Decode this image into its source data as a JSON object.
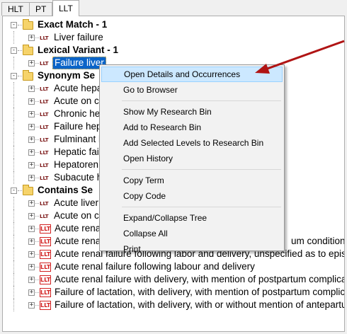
{
  "tabs": [
    "HLT",
    "PT",
    "LLT"
  ],
  "active_tab": "LLT",
  "icons": {
    "level_badge": "LLT",
    "folder": "folder-icon",
    "expander": "+",
    "collapser": "-"
  },
  "colors": {
    "selection": "#0a64c8",
    "menu_highlight": "#cce8ff",
    "arrow": "#b01414",
    "llt_badge": "#d22020"
  },
  "tree": [
    {
      "type": "group",
      "label": "Exact Match - 1"
    },
    {
      "type": "term",
      "label": "Liver failure",
      "icon": "small"
    },
    {
      "type": "group",
      "label": "Lexical Variant - 1"
    },
    {
      "type": "term",
      "label": "Failure liver",
      "icon": "small",
      "selected": true
    },
    {
      "type": "group",
      "label": "Synonym Se"
    },
    {
      "type": "term",
      "label": "Acute hepa",
      "icon": "small"
    },
    {
      "type": "term",
      "label": "Acute on c",
      "icon": "small"
    },
    {
      "type": "term",
      "label": "Chronic he",
      "icon": "small"
    },
    {
      "type": "term",
      "label": "Failure hep",
      "icon": "small"
    },
    {
      "type": "term",
      "label": "Fulminant h",
      "icon": "small"
    },
    {
      "type": "term",
      "label": "Hepatic fai",
      "icon": "small"
    },
    {
      "type": "term",
      "label": "Hepatoren",
      "icon": "small"
    },
    {
      "type": "term",
      "label": "Subacute h",
      "icon": "small"
    },
    {
      "type": "group",
      "label": "Contains Se"
    },
    {
      "type": "term",
      "label": "Acute liver",
      "icon": "small"
    },
    {
      "type": "term",
      "label": "Acute on c",
      "icon": "small"
    },
    {
      "type": "term",
      "label": "Acute renal",
      "icon": "box"
    },
    {
      "type": "term",
      "label": "Acute rena",
      "tail": "um condition",
      "icon": "box"
    },
    {
      "type": "term",
      "label": "Acute renal failure following labor and delivery, unspecified as to epis",
      "icon": "box"
    },
    {
      "type": "term",
      "label": "Acute renal failure following labour and delivery",
      "icon": "box"
    },
    {
      "type": "term",
      "label": "Acute renal failure with delivery, with mention of postpartum complicat",
      "icon": "box"
    },
    {
      "type": "term",
      "label": "Failure of lactation, with delivery, with mention of postpartum complica",
      "icon": "box"
    },
    {
      "type": "term",
      "label": "Failure of lactation, with delivery, with or without mention of antepartum",
      "icon": "box"
    }
  ],
  "context_menu": {
    "items": [
      "Open Details and Occurrences",
      "Go to Browser",
      "Show My Research Bin",
      "Add to Research Bin",
      "Add Selected Levels to Research Bin",
      "Open History",
      "Copy Term",
      "Copy Code",
      "Expand/Collapse Tree",
      "Collapse All",
      "Print"
    ],
    "highlighted_index": 0,
    "separators_after": [
      1,
      5,
      7
    ]
  }
}
